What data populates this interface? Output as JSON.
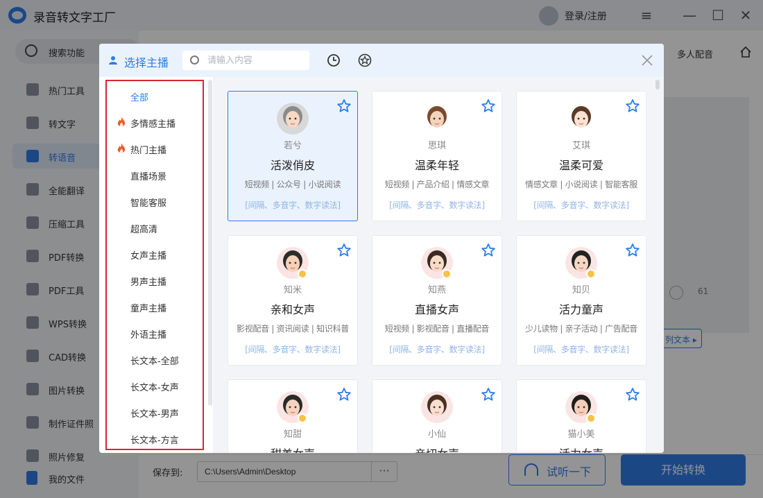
{
  "app": {
    "title": "录音转文字工厂",
    "login": "登录/注册"
  },
  "sidebar": {
    "search": "搜索功能",
    "items": [
      {
        "label": "热门工具",
        "icon": "fire-icon"
      },
      {
        "label": "转文字",
        "icon": "text-convert-icon"
      },
      {
        "label": "转语音",
        "icon": "voice-icon",
        "active": true
      },
      {
        "label": "全能翻译",
        "icon": "translate-icon"
      },
      {
        "label": "压缩工具",
        "icon": "compress-icon"
      },
      {
        "label": "PDF转换",
        "icon": "pdf-convert-icon"
      },
      {
        "label": "PDF工具",
        "icon": "toolbox-icon"
      },
      {
        "label": "WPS转换",
        "icon": "wps-icon"
      },
      {
        "label": "CAD转换",
        "icon": "cad-icon"
      },
      {
        "label": "图片转换",
        "icon": "image-icon"
      },
      {
        "label": "制作证件照",
        "icon": "id-photo-icon"
      },
      {
        "label": "照片修复",
        "icon": "photo-repair-icon"
      }
    ],
    "my_files": "我的文件"
  },
  "topnav": {
    "multi_voice": "多人配音"
  },
  "background": {
    "count": "61",
    "batch_text": "列文本"
  },
  "bottom": {
    "save_label": "保存到:",
    "save_path": "C:\\Users\\Admin\\Desktop",
    "browse": "···",
    "listen": "试听一下",
    "convert": "开始转换"
  },
  "modal": {
    "title": "选择主播",
    "search_placeholder": "请输入内容",
    "categories": [
      {
        "label": "全部",
        "active": true
      },
      {
        "label": "多情感主播",
        "hot": true
      },
      {
        "label": "热门主播",
        "hot": true
      },
      {
        "label": "直播场景"
      },
      {
        "label": "智能客服"
      },
      {
        "label": "超高清"
      },
      {
        "label": "女声主播"
      },
      {
        "label": "男声主播"
      },
      {
        "label": "童声主播"
      },
      {
        "label": "外语主播"
      },
      {
        "label": "长文本-全部"
      },
      {
        "label": "长文本-女声"
      },
      {
        "label": "长文本-男声"
      },
      {
        "label": "长文本-方言"
      }
    ],
    "cards": [
      {
        "name": "若兮",
        "style": "活泼俏皮",
        "tags": "短视频 | 公众号 | 小说阅读",
        "features": "[间隔、多音字、数字读法]",
        "selected": true,
        "vip": false
      },
      {
        "name": "思琪",
        "style": "温柔年轻",
        "tags": "短视频 | 产品介绍 | 情感文章",
        "features": "[间隔、多音字、数字读法]",
        "vip": false
      },
      {
        "name": "艾琪",
        "style": "温柔可爱",
        "tags": "情感文章 | 小说阅读 | 智能客服",
        "features": "[间隔、多音字、数字读法]",
        "vip": false
      },
      {
        "name": "知米",
        "style": "亲和女声",
        "tags": "影视配音 | 资讯阅读 | 知识科普",
        "features": "[间隔、多音字、数字读法]",
        "vip": true
      },
      {
        "name": "知燕",
        "style": "直播女声",
        "tags": "短视频 | 影视配音 | 直播配音",
        "features": "[间隔、多音字、数字读法]",
        "vip": true
      },
      {
        "name": "知贝",
        "style": "活力童声",
        "tags": "少儿读物 | 亲子活动 | 广告配音",
        "features": "[间隔、多音字、数字读法]",
        "vip": true
      },
      {
        "name": "知甜",
        "style": "甜美女声",
        "tags": "",
        "features": "",
        "vip": true
      },
      {
        "name": "小仙",
        "style": "亲切女声",
        "tags": "",
        "features": "",
        "vip": false
      },
      {
        "name": "猫小美",
        "style": "活力女声",
        "tags": "",
        "features": "",
        "vip": true
      }
    ]
  },
  "colors": {
    "accent": "#2f7be5",
    "highlight_border": "#d4262d",
    "fire": "#ef5a2b"
  }
}
